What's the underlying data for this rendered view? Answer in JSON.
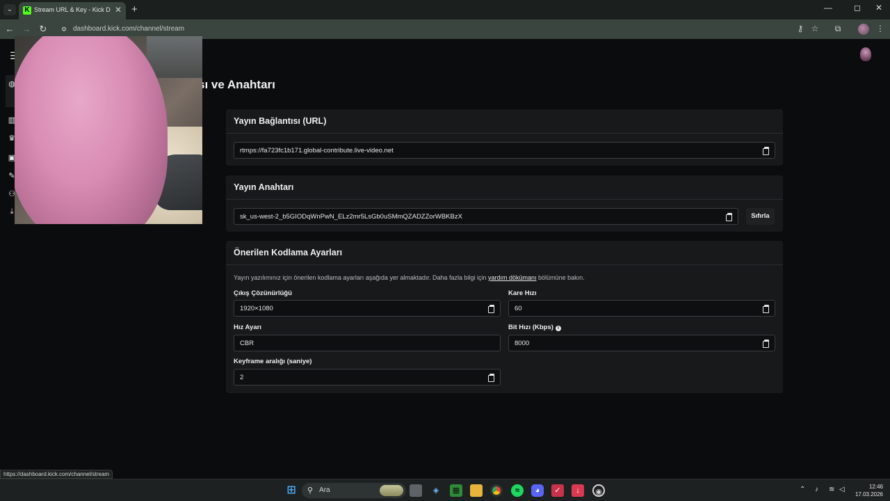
{
  "browser": {
    "tab_title": "Stream URL & Key - Kick Dashb",
    "tab_favicon": "K",
    "new_tab_label": "+",
    "tab_close": "✕",
    "url": "dashboard.kick.com/channel/stream",
    "status_url": "https://dashboard.kick.com/channel/stream",
    "controls": {
      "minimize": "—",
      "maximize": "◻",
      "close": "✕"
    }
  },
  "page": {
    "title_visible": "sı ve Anahtarı",
    "url_card": {
      "title": "Yayın Bağlantısı (URL)",
      "value": "rtmps://fa723fc1b171.global-contribute.live-video.net"
    },
    "key_card": {
      "title": "Yayın Anahtarı",
      "value": "sk_us-west-2_b5GIODqWnPwN_ELz2mr5LsGb0uSMmQZADZZorWBKBzX",
      "reset_label": "Sıfırla"
    },
    "encoding_card": {
      "title": "Önerilen Kodlama Ayarları",
      "desc_before": "Yayın yazılımınız için önerilen kodlama ayarları aşağıda yer almaktadır. Daha fazla bilgi için ",
      "desc_link": "yardım dökümanı",
      "desc_after": " bölümüne bakın.",
      "resolution_label": "Çıkış Çözünürlüğü",
      "resolution_value": "1920×1080",
      "framerate_label": "Kare Hızı",
      "framerate_value": "60",
      "ratecontrol_label": "Hız Ayarı",
      "ratecontrol_value": "CBR",
      "bitrate_label": "Bit Hızı (Kbps)",
      "bitrate_value": "8000",
      "keyframe_label": "Keyframe aralığı (saniye)",
      "keyframe_value": "2"
    }
  },
  "taskbar": {
    "search_placeholder": "Ara",
    "time": "12:46",
    "date": "17.03.2026"
  },
  "colors": {
    "kick_green": "#53fc18",
    "background": "#0b0c0d",
    "card": "#18191b"
  }
}
